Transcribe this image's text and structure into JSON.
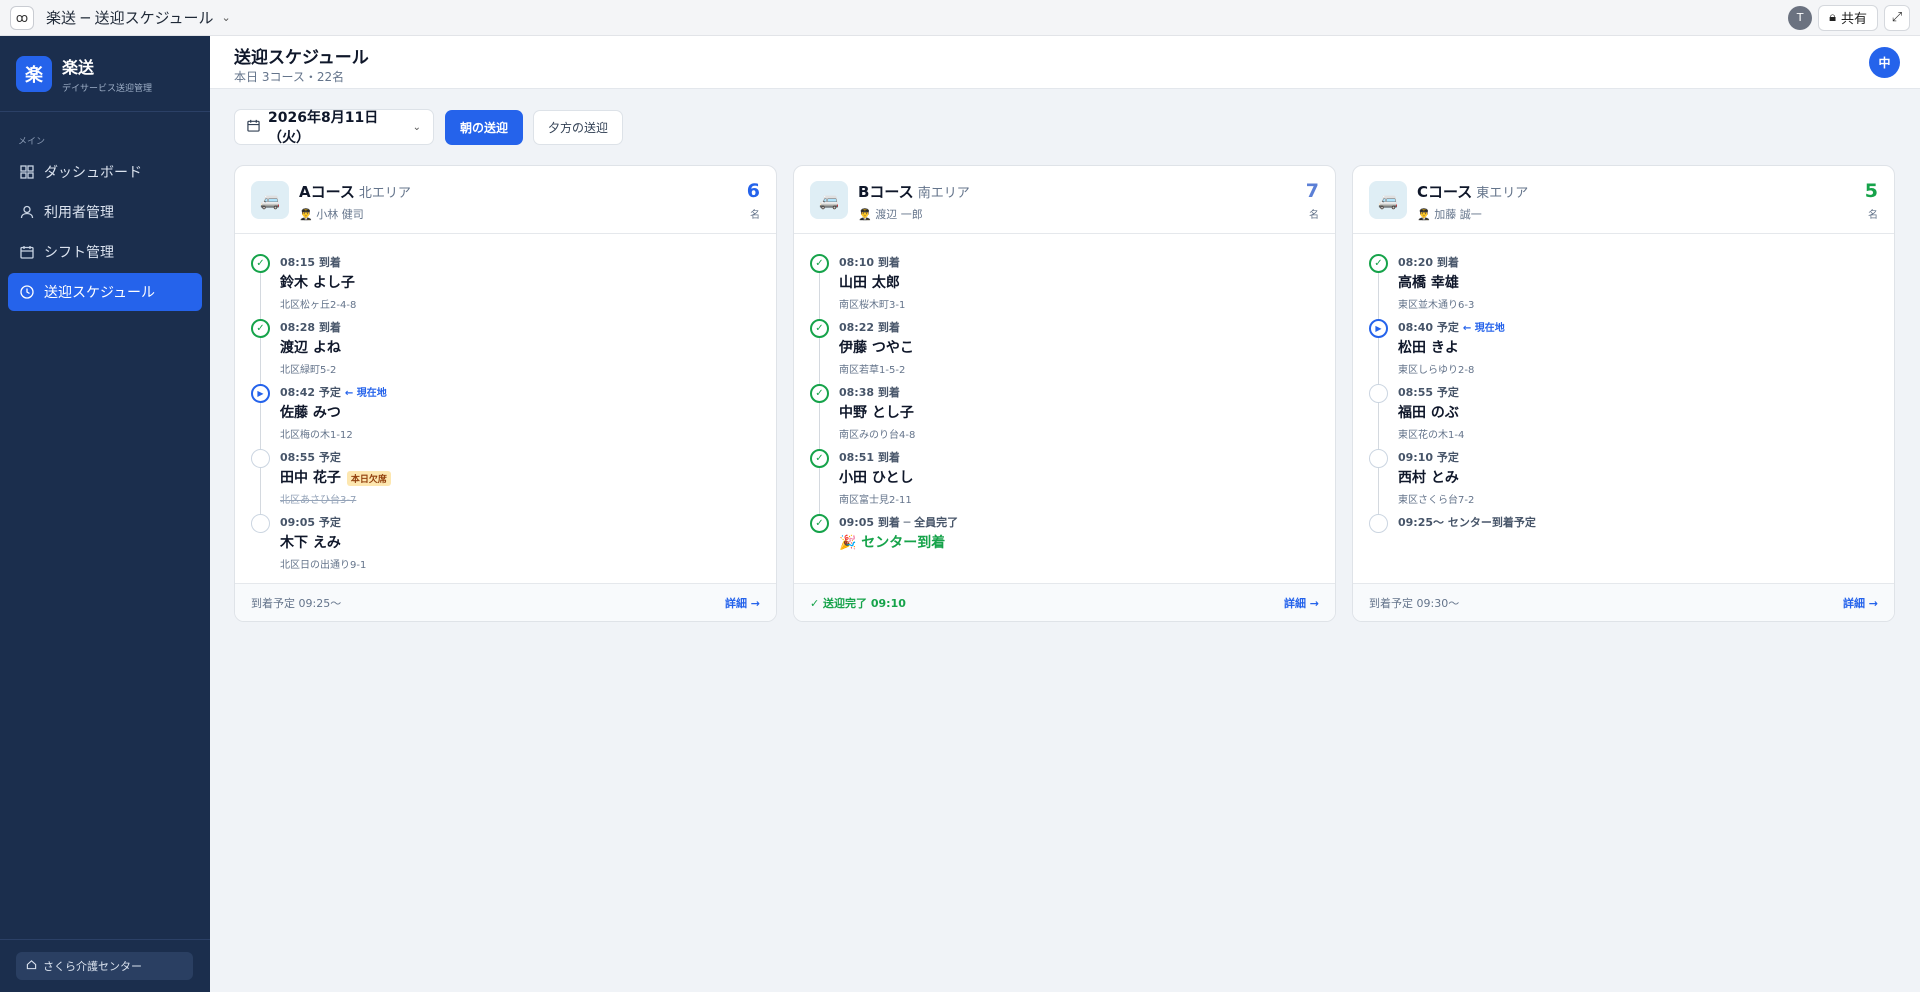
{
  "window": {
    "app_icon": "ab-icon",
    "title": "楽送 ─ 送迎スケジュール",
    "user_initial": "T",
    "share_label": "共有"
  },
  "sidebar": {
    "brand_logo": "楽",
    "brand_name": "楽送",
    "brand_sub": "デイサービス送迎管理",
    "section": "メイン",
    "items": [
      {
        "label": "ダッシュボード",
        "icon": "grid-icon"
      },
      {
        "label": "利用者管理",
        "icon": "user-icon"
      },
      {
        "label": "シフト管理",
        "icon": "calendar-icon"
      },
      {
        "label": "送迎スケジュール",
        "icon": "clock-icon"
      }
    ],
    "facility": "さくら介護センター"
  },
  "header": {
    "title": "送迎スケジュール",
    "subtitle": "本日 3コース・22名",
    "user_initial": "中"
  },
  "toolbar": {
    "date": "2026年8月11日（火）",
    "tab_am": "朝の送迎",
    "tab_pm": "夕方の送迎"
  },
  "courses": [
    {
      "name": "Aコース",
      "area": "北エリア",
      "driver": "小林 健司",
      "count": "6",
      "unit": "名",
      "count_color": "#2563eb",
      "stops": [
        {
          "time": "08:15 到着",
          "name": "鈴木 よし子",
          "addr": "北区松ヶ丘2-4-8"
        },
        {
          "time": "08:28 到着",
          "name": "渡辺 よね",
          "addr": "北区緑町5-2"
        },
        {
          "time": "08:42 予定",
          "tag": "← 現在地",
          "name": "佐藤 みつ",
          "addr": "北区梅の木1-12"
        },
        {
          "time": "08:55 予定",
          "name": "田中 花子",
          "badge": "本日欠席",
          "addr": "北区あさひ台3-7"
        },
        {
          "time": "09:05 予定",
          "name": "木下 えみ",
          "addr": "北区日の出通り9-1"
        }
      ],
      "footer": "到着予定 09:25〜",
      "detail": "詳細 →"
    },
    {
      "name": "Bコース",
      "area": "南エリア",
      "driver": "渡辺 一郎",
      "count": "7",
      "unit": "名",
      "count_color": "#5b7fd6",
      "stops": [
        {
          "time": "08:10 到着",
          "name": "山田 太郎",
          "addr": "南区桜木町3-1"
        },
        {
          "time": "08:22 到着",
          "name": "伊藤 つやこ",
          "addr": "南区若草1-5-2"
        },
        {
          "time": "08:38 到着",
          "name": "中野 とし子",
          "addr": "南区みのり台4-8"
        },
        {
          "time": "08:51 到着",
          "name": "小田 ひとし",
          "addr": "南区富士見2-11"
        },
        {
          "time": "09:05 到着 ─ 全員完了",
          "arrive": "🎉 センター到着"
        }
      ],
      "footer": "✓ 送迎完了 09:10",
      "detail": "詳細 →"
    },
    {
      "name": "Cコース",
      "area": "東エリア",
      "driver": "加藤 誠一",
      "count": "5",
      "unit": "名",
      "count_color": "#16a34a",
      "stops": [
        {
          "time": "08:20 到着",
          "name": "高橋 幸雄",
          "addr": "東区並木通り6-3"
        },
        {
          "time": "08:40 予定",
          "tag": "← 現在地",
          "name": "松田 きよ",
          "addr": "東区しらゆり2-8"
        },
        {
          "time": "08:55 予定",
          "name": "福田 のぶ",
          "addr": "東区花の木1-4"
        },
        {
          "time": "09:10 予定",
          "name": "西村 とみ",
          "addr": "東区さくら台7-2"
        },
        {
          "time": "09:25〜 センター到着予定"
        }
      ],
      "footer": "到着予定 09:30〜",
      "detail": "詳細 →"
    }
  ]
}
